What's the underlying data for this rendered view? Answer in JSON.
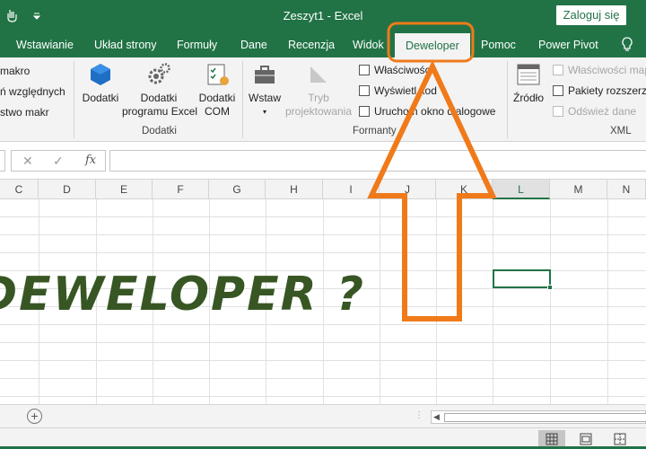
{
  "titlebar": {
    "doc_title": "Zeszyt1  -  Excel",
    "login_label": "Zaloguj się"
  },
  "tabs": [
    {
      "label": "Wstawianie"
    },
    {
      "label": "Układ strony"
    },
    {
      "label": "Formuły"
    },
    {
      "label": "Dane"
    },
    {
      "label": "Recenzja"
    },
    {
      "label": "Widok"
    },
    {
      "label": "Deweloper",
      "active": true
    },
    {
      "label": "Pomoc"
    },
    {
      "label": "Power Pivot"
    }
  ],
  "ribbon": {
    "code_items": [
      "makro",
      "ń względnych",
      "stwo makr"
    ],
    "addins": {
      "items": [
        "Dodatki",
        "Dodatki\nprogramu Excel",
        "Dodatki\nCOM"
      ],
      "group_label": "Dodatki"
    },
    "controls": {
      "insert_label": "Wstaw",
      "design_mode_label": "Tryb\nprojektowania",
      "properties_label": "Właściwości",
      "view_code_label": "Wyświetl kod",
      "run_dialog_label": "Uruchom okno dialogowe",
      "group_label": "Formanty"
    },
    "xml": {
      "source_label": "Źródło",
      "map_properties_label": "Właściwości mapy",
      "expansion_packs_label": "Pakiety rozszerzeń",
      "refresh_data_label": "Odśwież dane",
      "group_label": "XML"
    }
  },
  "formula_bar": {
    "cancel_symbol": "✕",
    "enter_symbol": "✓",
    "fx_label": "fx",
    "value": ""
  },
  "columns": [
    "C",
    "D",
    "E",
    "F",
    "G",
    "H",
    "I",
    "J",
    "K",
    "L",
    "M",
    "N"
  ],
  "selected_column": "L",
  "cell_text": "DEWELOPER ?",
  "sheetbar": {
    "add_symbol": "+",
    "dots": "⋮"
  },
  "colors": {
    "excel_green": "#217346",
    "annotation_orange": "#f07a1a",
    "text_green": "#375623"
  }
}
